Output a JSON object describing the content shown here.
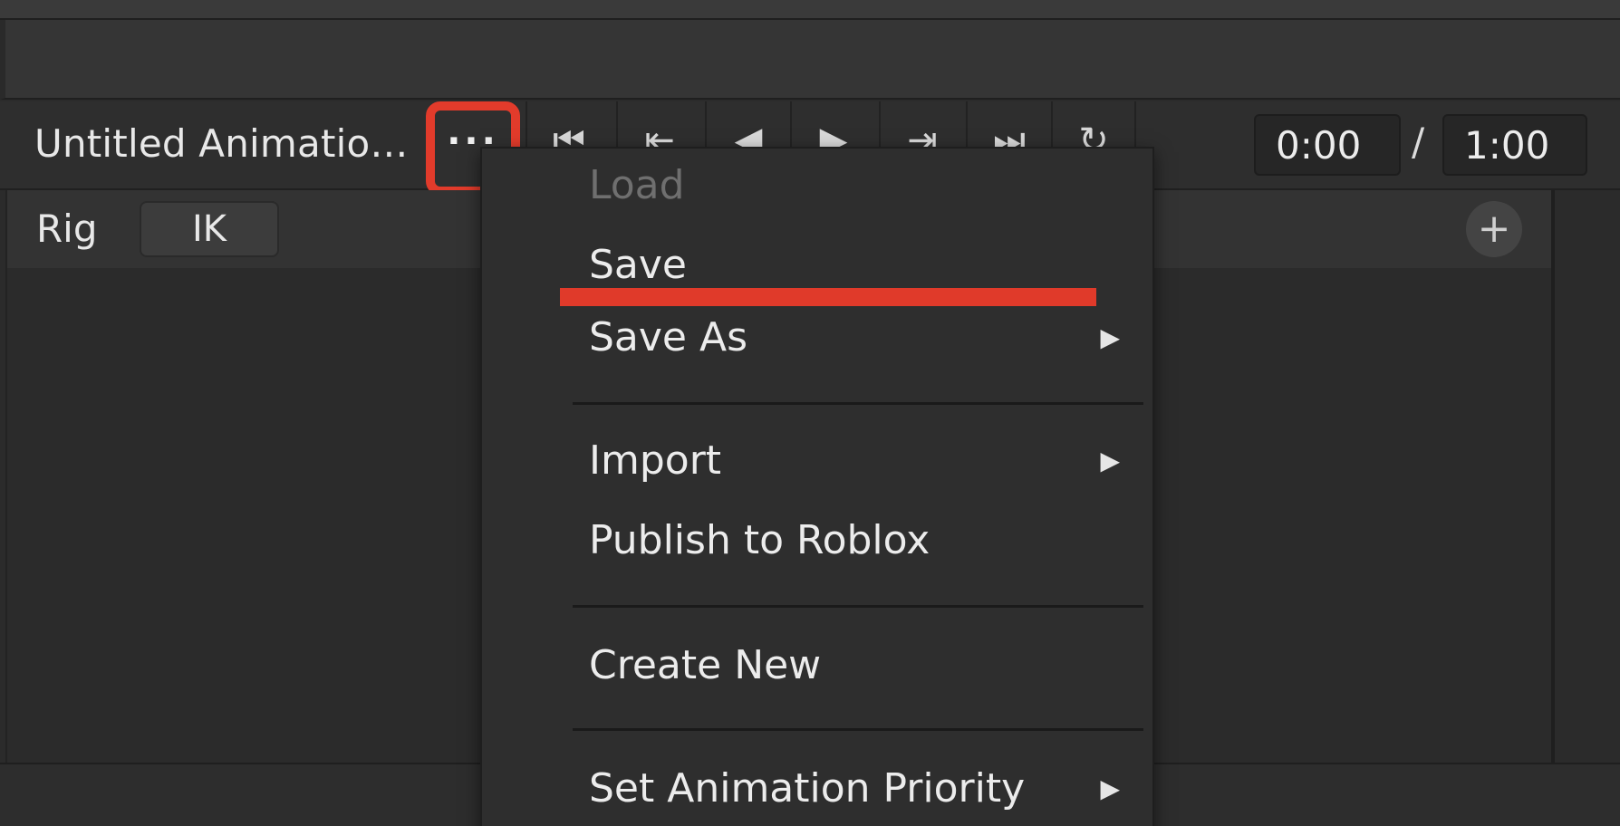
{
  "toolbar": {
    "title": "Untitled Animatio…",
    "more_label": "···",
    "transport": {
      "first": "⏮",
      "prev_key": "⇤",
      "prev_frame": "◀",
      "play": "▶",
      "next_key": "⇥",
      "last": "⏭",
      "loop": "↻"
    },
    "time_current": "0:00",
    "time_separator": "/",
    "time_total": "1:00"
  },
  "rig_row": {
    "rig_label": "Rig",
    "ik_label": "IK",
    "add_label": "+"
  },
  "menu": {
    "items": [
      {
        "label": "Load",
        "disabled": true
      },
      {
        "label": "Save"
      },
      {
        "label": "Save As",
        "submenu": true
      },
      {
        "label": "Import",
        "submenu": true
      },
      {
        "label": "Publish to Roblox"
      },
      {
        "label": "Create New"
      },
      {
        "label": "Set Animation Priority",
        "submenu": true
      }
    ],
    "submenu_arrow": "▶"
  },
  "colors": {
    "highlight_red": "#e23b2b",
    "background": "#2b2b2b",
    "menu_bg": "#2e2e2e",
    "disabled_text": "#6f6f6f"
  }
}
